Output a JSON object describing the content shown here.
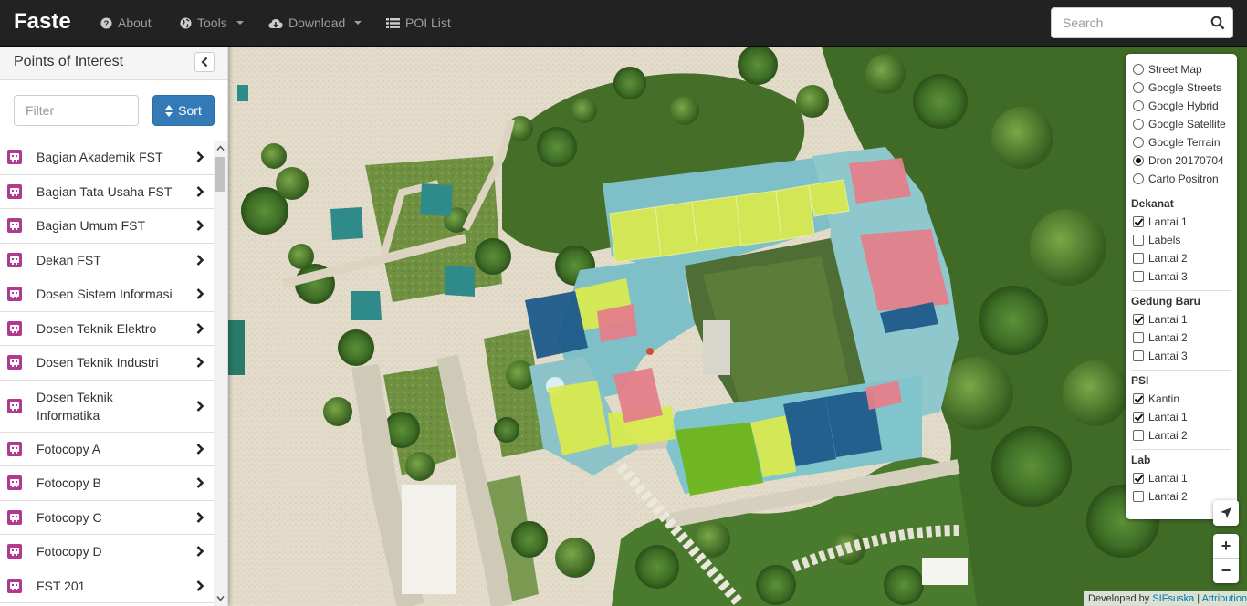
{
  "navbar": {
    "brand": "Faste",
    "items": [
      {
        "label": "About",
        "icon": "question-circle-icon",
        "dropdown": false
      },
      {
        "label": "Tools",
        "icon": "globe-icon",
        "dropdown": true
      },
      {
        "label": "Download",
        "icon": "cloud-download-icon",
        "dropdown": true
      },
      {
        "label": "POI List",
        "icon": "list-icon",
        "dropdown": false
      }
    ],
    "search_placeholder": "Search"
  },
  "sidebar": {
    "title": "Points of Interest",
    "filter_placeholder": "Filter",
    "sort_label": "Sort",
    "items": [
      {
        "label": "Bagian Akademik FST"
      },
      {
        "label": "Bagian Tata Usaha FST"
      },
      {
        "label": "Bagian Umum FST"
      },
      {
        "label": "Dekan FST"
      },
      {
        "label": "Dosen Sistem Informasi"
      },
      {
        "label": "Dosen Teknik Elektro"
      },
      {
        "label": "Dosen Teknik Industri"
      },
      {
        "label": "Dosen Teknik Informatika"
      },
      {
        "label": "Fotocopy A"
      },
      {
        "label": "Fotocopy B"
      },
      {
        "label": "Fotocopy C"
      },
      {
        "label": "Fotocopy D"
      },
      {
        "label": "FST 201"
      }
    ]
  },
  "layers": {
    "basemaps": [
      {
        "label": "Street Map",
        "selected": false
      },
      {
        "label": "Google Streets",
        "selected": false
      },
      {
        "label": "Google Hybrid",
        "selected": false
      },
      {
        "label": "Google Satellite",
        "selected": false
      },
      {
        "label": "Google Terrain",
        "selected": false
      },
      {
        "label": "Dron 20170704",
        "selected": true
      },
      {
        "label": "Carto Positron",
        "selected": false
      }
    ],
    "groups": [
      {
        "name": "Dekanat",
        "items": [
          {
            "label": "Lantai 1",
            "checked": true
          },
          {
            "label": "Labels",
            "checked": false
          },
          {
            "label": "Lantai 2",
            "checked": false
          },
          {
            "label": "Lantai 3",
            "checked": false
          }
        ]
      },
      {
        "name": "Gedung Baru",
        "items": [
          {
            "label": "Lantai 1",
            "checked": true
          },
          {
            "label": "Lantai 2",
            "checked": false
          },
          {
            "label": "Lantai 3",
            "checked": false
          }
        ]
      },
      {
        "name": "PSI",
        "items": [
          {
            "label": "Kantin",
            "checked": true
          },
          {
            "label": "Lantai 1",
            "checked": true
          },
          {
            "label": "Lantai 2",
            "checked": false
          }
        ]
      },
      {
        "name": "Lab",
        "items": [
          {
            "label": "Lantai 1",
            "checked": true
          },
          {
            "label": "Lantai 2",
            "checked": false
          }
        ]
      }
    ]
  },
  "map_controls": {
    "zoom_in": "+",
    "zoom_out": "−",
    "locate_icon": "location-arrow-icon"
  },
  "attribution": {
    "prefix": "Developed by",
    "author": "SIFsuska",
    "separator": "|",
    "link": "Attribution"
  },
  "colors": {
    "navbar_bg": "#222222",
    "primary": "#337ab7",
    "poi_icon": "#b03a8e",
    "overlay_yellow": "#d8ea50",
    "overlay_pink": "#e47f8a",
    "overlay_blue": "#1f5a8a",
    "overlay_green": "#6fb51a"
  }
}
